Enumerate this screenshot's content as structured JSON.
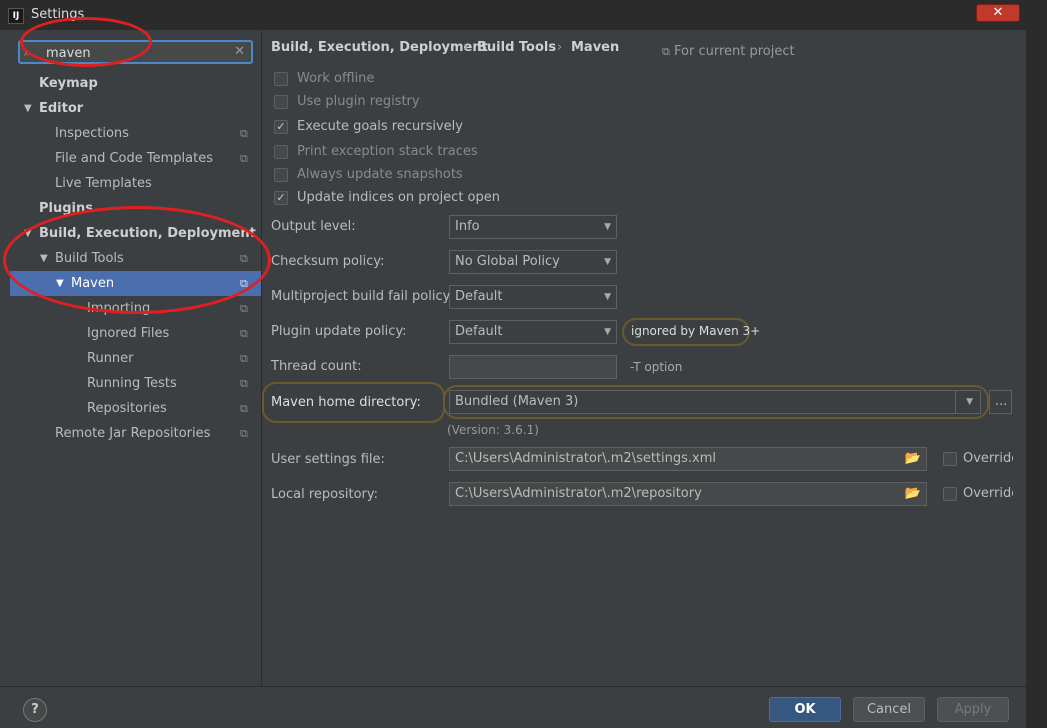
{
  "window": {
    "title": "Settings",
    "app_icon": "IJ",
    "close": "✕"
  },
  "search": {
    "value": "maven",
    "clear": "✕"
  },
  "tree": [
    {
      "label": "Keymap"
    },
    {
      "label": "Editor"
    },
    {
      "label": "Inspections"
    },
    {
      "label": "File and Code Templates"
    },
    {
      "label": "Live Templates"
    },
    {
      "label": "Plugins"
    },
    {
      "label": "Build, Execution, Deployment"
    },
    {
      "label": "Build Tools"
    },
    {
      "label": "Maven"
    },
    {
      "label": "Importing"
    },
    {
      "label": "Ignored Files"
    },
    {
      "label": "Runner"
    },
    {
      "label": "Running Tests"
    },
    {
      "label": "Repositories"
    },
    {
      "label": "Remote Jar Repositories"
    }
  ],
  "breadcrumb": {
    "items": [
      "Build, Execution, Deployment",
      "Build Tools",
      "Maven"
    ],
    "sep": "›",
    "scope": "For current project"
  },
  "checkboxes": [
    {
      "label": "Work offline",
      "checked": false
    },
    {
      "label": "Use plugin registry",
      "checked": false
    },
    {
      "label": "Execute goals recursively",
      "checked": true
    },
    {
      "label": "Print exception stack traces",
      "checked": false
    },
    {
      "label": "Always update snapshots",
      "checked": false
    },
    {
      "label": "Update indices on project open",
      "checked": true
    }
  ],
  "fields": {
    "output_level": {
      "label": "Output level:",
      "value": "Info"
    },
    "checksum_policy": {
      "label": "Checksum policy:",
      "value": "No Global Policy"
    },
    "fail_policy": {
      "label": "Multiproject build fail policy:",
      "value": "Default"
    },
    "plugin_update": {
      "label": "Plugin update policy:",
      "value": "Default",
      "note": "ignored by Maven 3+"
    },
    "thread_count": {
      "label": "Thread count:",
      "value": "",
      "note": "-T option"
    },
    "maven_home": {
      "label": "Maven home directory:",
      "value": "Bundled (Maven 3)",
      "browse": "...",
      "version": "(Version: 3.6.1)"
    },
    "user_settings": {
      "label": "User settings file:",
      "value": "C:\\Users\\Administrator\\.m2\\settings.xml",
      "override": "Override"
    },
    "local_repo": {
      "label": "Local repository:",
      "value": "C:\\Users\\Administrator\\.m2\\repository",
      "override": "Override"
    }
  },
  "buttons": {
    "help": "?",
    "ok": "OK",
    "cancel": "Cancel",
    "apply": "Apply"
  },
  "colors": {
    "background": "#3c3f41",
    "selection": "#4b6eaf",
    "annotation_red": "#e02020",
    "annotation_brown": "#6b5a2d"
  }
}
